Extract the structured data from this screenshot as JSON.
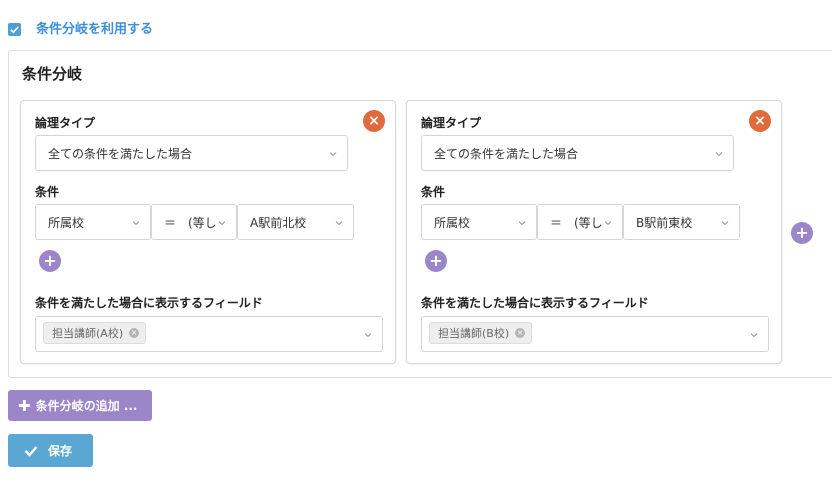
{
  "use_branch": {
    "label": "条件分岐を利用する",
    "checked": true
  },
  "panel": {
    "title": "条件分岐"
  },
  "branches": [
    {
      "logic_label": "論理タイプ",
      "logic_value": "全ての条件を満たした場合",
      "conditions_label": "条件",
      "condition": {
        "field": "所属校",
        "operator": "＝　(等しい)",
        "value": "A駅前北校"
      },
      "display_fields_label": "条件を満たした場合に表示するフィールド",
      "display_fields": [
        "担当講師(A校)"
      ]
    },
    {
      "logic_label": "論理タイプ",
      "logic_value": "全ての条件を満たした場合",
      "conditions_label": "条件",
      "condition": {
        "field": "所属校",
        "operator": "＝　(等しい)",
        "value": "B駅前東校"
      },
      "display_fields_label": "条件を満たした場合に表示するフィールド",
      "display_fields": [
        "担当講師(B校)"
      ]
    }
  ],
  "buttons": {
    "add_branch": "条件分岐の追加 ...",
    "save": "保存"
  },
  "icons": {
    "remove": "remove-icon",
    "add": "plus-icon",
    "check": "check-icon",
    "chevron": "chevron-down-icon"
  },
  "colors": {
    "accent_blue": "#4d9fd9",
    "remove_orange": "#e06a3c",
    "add_purple": "#9a86c9",
    "save_blue": "#5aa7d4"
  }
}
